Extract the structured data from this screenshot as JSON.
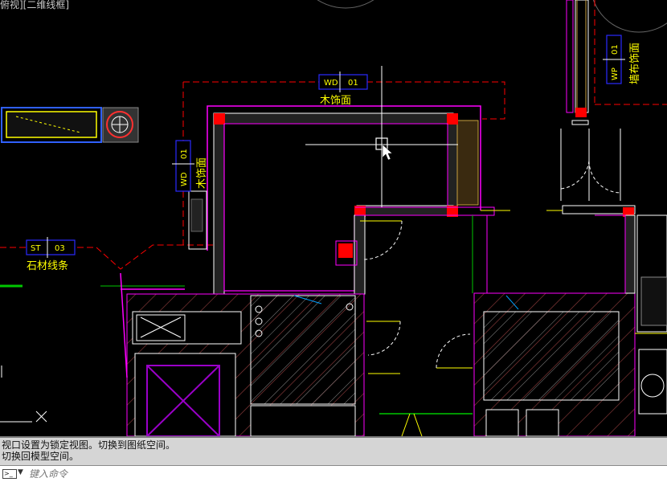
{
  "viewport": {
    "label": "俯视][二维线框]"
  },
  "annotations": {
    "wd_top": {
      "code": "WD",
      "number": "01",
      "material": "木饰面"
    },
    "wd_left": {
      "code": "WD",
      "number": "01",
      "material": "木饰面"
    },
    "st": {
      "code": "ST",
      "number": "03",
      "material": "石材线条"
    },
    "wp": {
      "code": "WP",
      "number": "01",
      "material": "墙布饰面"
    }
  },
  "command_history": [
    "视口设置为锁定视图。切换到图纸空间。",
    "切换回模型空间。"
  ],
  "command_line": {
    "placeholder": "键入命令"
  },
  "colors": {
    "background": "#000000",
    "wall_magenta": "#ff00ff",
    "red_boundary": "#ff0000",
    "annotation_blue": "#2a2aff",
    "text_yellow": "#ffff00",
    "hatch_brown": "#8a3a3a",
    "green": "#00c800"
  }
}
